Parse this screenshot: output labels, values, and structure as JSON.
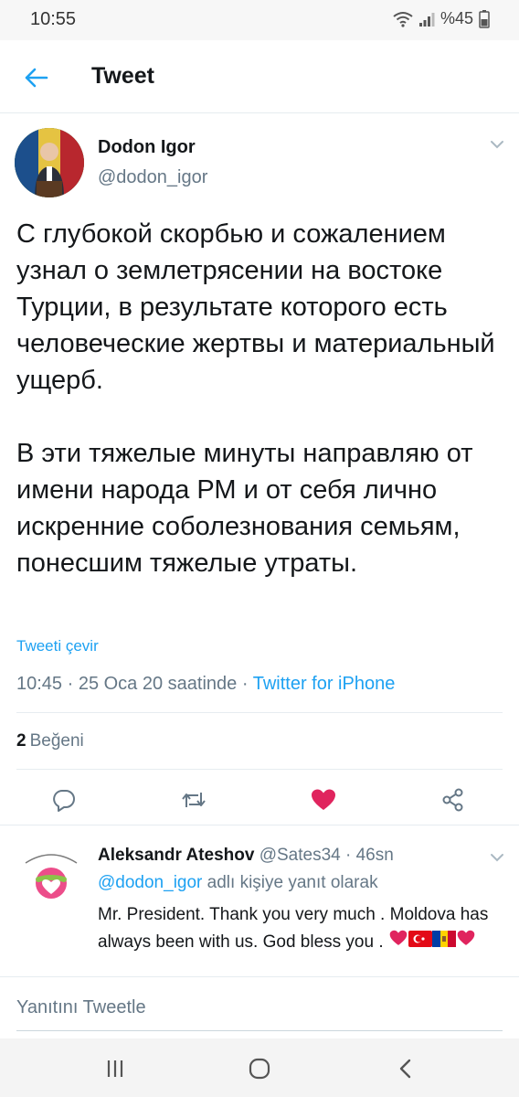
{
  "status_bar": {
    "time": "10:55",
    "battery": "%45",
    "icons": [
      "wifi-icon",
      "signal-icon",
      "battery-icon"
    ]
  },
  "header": {
    "title": "Tweet",
    "back_icon": "back-arrow-icon"
  },
  "tweet": {
    "author_name": "Dodon Igor",
    "author_handle": "@dodon_igor",
    "paragraphs": [
      "С глубокой скорбью и сожалением узнал о землетрясении на востоке Турции, в результате которого есть человеческие жертвы и материальный ущерб.",
      "В эти тяжелые минуты направляю от имени народа РМ и от себя лично искренние соболезнования семьям, понесшим тяжелые утраты."
    ],
    "translate_label": "Tweeti çevir",
    "timestamp": "10:45 · 25 Oca 20 saatinde · ",
    "source": "Twitter for iPhone",
    "likes_count": "2",
    "likes_label": "Beğeni"
  },
  "actions": {
    "icons": [
      "reply-icon",
      "retweet-icon",
      "like-icon",
      "share-icon"
    ],
    "like_color": "#e0245e"
  },
  "reply": {
    "author_name": "Aleksandr Ateshov",
    "author_handle": "@Sates34",
    "time": " · 46sn",
    "context_mention": "@dodon_igor",
    "context_text": " adlı kişiye yanıt olarak",
    "text": "Mr. President.  Thank you very much . Moldova has always been with us.  God bless you ."
  },
  "compose": {
    "placeholder": "Yanıtını Tweetle"
  },
  "nav": {
    "icons": [
      "recent-apps-icon",
      "home-icon",
      "back-icon"
    ]
  },
  "colors": {
    "accent": "#1da1f2",
    "secondary_text": "#657786",
    "like": "#e0245e"
  }
}
